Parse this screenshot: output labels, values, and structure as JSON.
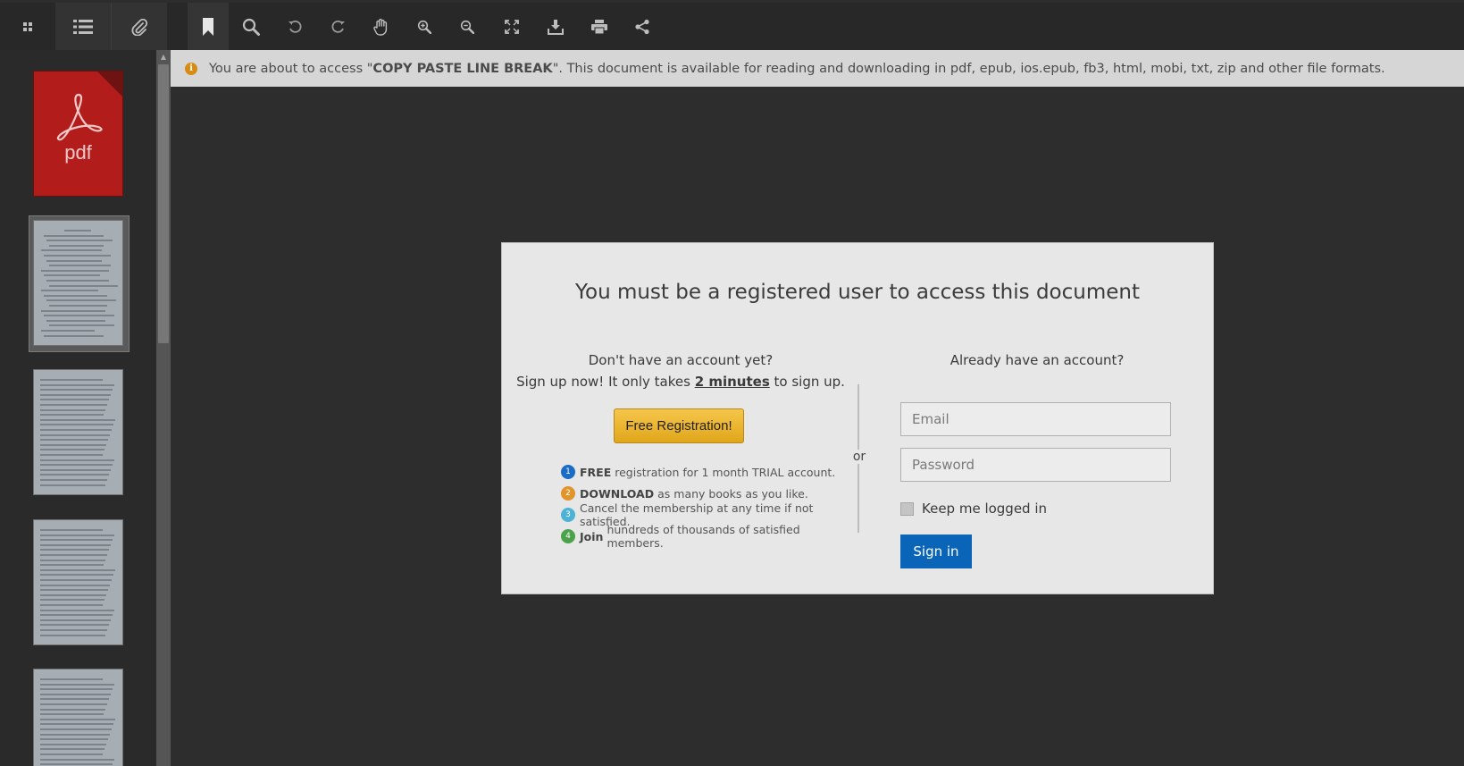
{
  "toolbar": {
    "buttons": [
      {
        "name": "thumbnails-icon"
      },
      {
        "name": "outline-icon"
      },
      {
        "name": "attachment-icon"
      },
      {
        "name": "bookmark-icon"
      },
      {
        "name": "search-icon"
      },
      {
        "name": "rotate-left-icon"
      },
      {
        "name": "rotate-right-icon"
      },
      {
        "name": "hand-tool-icon"
      },
      {
        "name": "zoom-in-icon"
      },
      {
        "name": "zoom-out-icon"
      },
      {
        "name": "fullscreen-icon"
      },
      {
        "name": "download-icon"
      },
      {
        "name": "print-icon"
      },
      {
        "name": "share-icon"
      }
    ]
  },
  "sidebar": {
    "pdf_thumb_label": "pdf"
  },
  "notice": {
    "prefix": "You are about to access \"",
    "doc_title": "COPY PASTE LINE BREAK",
    "suffix": "\". This document is available for reading and downloading in pdf, epub, ios.epub, fb3, html, mobi, txt, zip and other file formats."
  },
  "modal": {
    "title": "You must be a registered user to access this document",
    "left": {
      "question": "Don't have an account yet?",
      "signup_prefix": "Sign up now! It only takes ",
      "signup_emph": "2 minutes",
      "signup_suffix": " to sign up.",
      "register_button": "Free Registration!",
      "benefits": [
        {
          "num": "1",
          "color": "#1a6cc4",
          "bold": "FREE",
          "text": "registration for 1 month TRIAL account."
        },
        {
          "num": "2",
          "color": "#e0942a",
          "bold": "DOWNLOAD",
          "text": "as many books as you like."
        },
        {
          "num": "3",
          "color": "#4db3d6",
          "bold": "",
          "text": "Cancel the membership at any time if not satisfied."
        },
        {
          "num": "4",
          "color": "#4ca24a",
          "bold": "Join",
          "text": "hundreds of thousands of satisfied members."
        }
      ]
    },
    "or_label": "or",
    "right": {
      "question": "Already have an account?",
      "email_placeholder": "Email",
      "password_placeholder": "Password",
      "keep_logged_in": "Keep me logged in",
      "signin_button": "Sign in"
    }
  }
}
